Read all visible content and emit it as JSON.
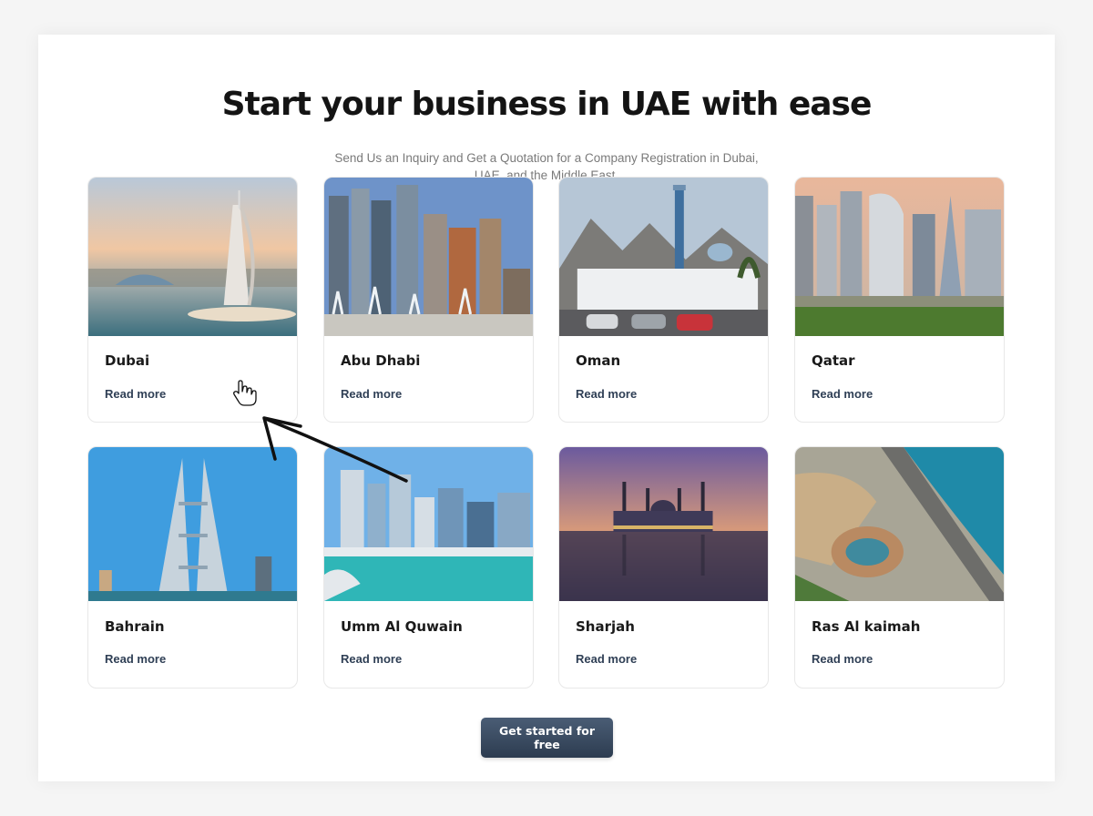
{
  "hero": {
    "title": "Start your business in UAE with ease",
    "subtitle": "Send Us an Inquiry and Get a Quotation for a Company Registration in Dubai, UAE, and the Middle East."
  },
  "cards": [
    {
      "title": "Dubai",
      "link_label": "Read more"
    },
    {
      "title": "Abu Dhabi",
      "link_label": "Read more"
    },
    {
      "title": "Oman",
      "link_label": "Read more"
    },
    {
      "title": "Qatar",
      "link_label": "Read more"
    },
    {
      "title": "Bahrain",
      "link_label": "Read more"
    },
    {
      "title": "Umm Al Quwain",
      "link_label": "Read more"
    },
    {
      "title": "Sharjah",
      "link_label": "Read more"
    },
    {
      "title": "Ras Al kaimah",
      "link_label": "Read more"
    }
  ],
  "cta": {
    "label": "Get started for free"
  },
  "colors": {
    "accent": "#2f3f55",
    "button": "#3b4c62",
    "title": "#141414"
  },
  "overlay": {
    "cursor_icon": "hand-pointer-icon",
    "annotation_icon": "arrow-icon"
  }
}
